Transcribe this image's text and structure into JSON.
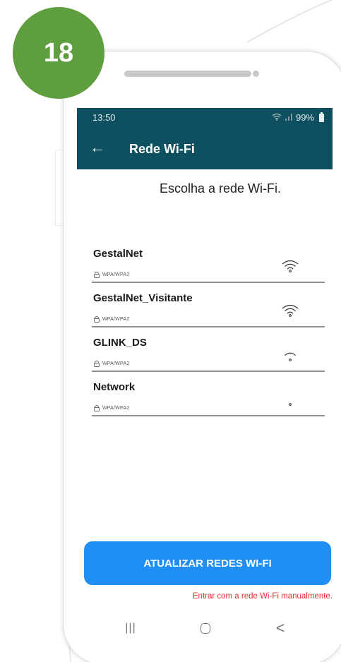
{
  "badge": {
    "number": "18",
    "color": "#5e9e3f"
  },
  "status_bar": {
    "time": "13:50",
    "wifi_icon": "wifi-icon",
    "signal_icon": "signal-icon",
    "battery": "99%",
    "battery_icon": "battery-icon"
  },
  "app_bar": {
    "back_icon": "arrow-left-icon",
    "title": "Rede Wi-Fi",
    "color": "#0f5060"
  },
  "subtitle": "Escolha a rede Wi-Fi.",
  "networks": [
    {
      "name": "GestalNet",
      "security": "WPA/WPA2",
      "signal_strength": 3
    },
    {
      "name": "GestalNet_Visitante",
      "security": "WPA/WPA2",
      "signal_strength": 3
    },
    {
      "name": "GLINK_DS",
      "security": "WPA/WPA2",
      "signal_strength": 2
    },
    {
      "name": "Network",
      "security": "WPA/WPA2",
      "signal_strength": 1
    }
  ],
  "refresh_button": {
    "label": "ATUALIZAR REDES WI-FI",
    "color": "#1f8ff5"
  },
  "manual_link": {
    "label": "Entrar com a rede Wi-Fi manualmente.",
    "color": "#e33030"
  },
  "nav_bar": {
    "recents_glyph": "|||",
    "recents_icon": "recents-icon",
    "home_icon": "home-icon",
    "back_glyph": "<",
    "back_icon": "back-icon"
  }
}
